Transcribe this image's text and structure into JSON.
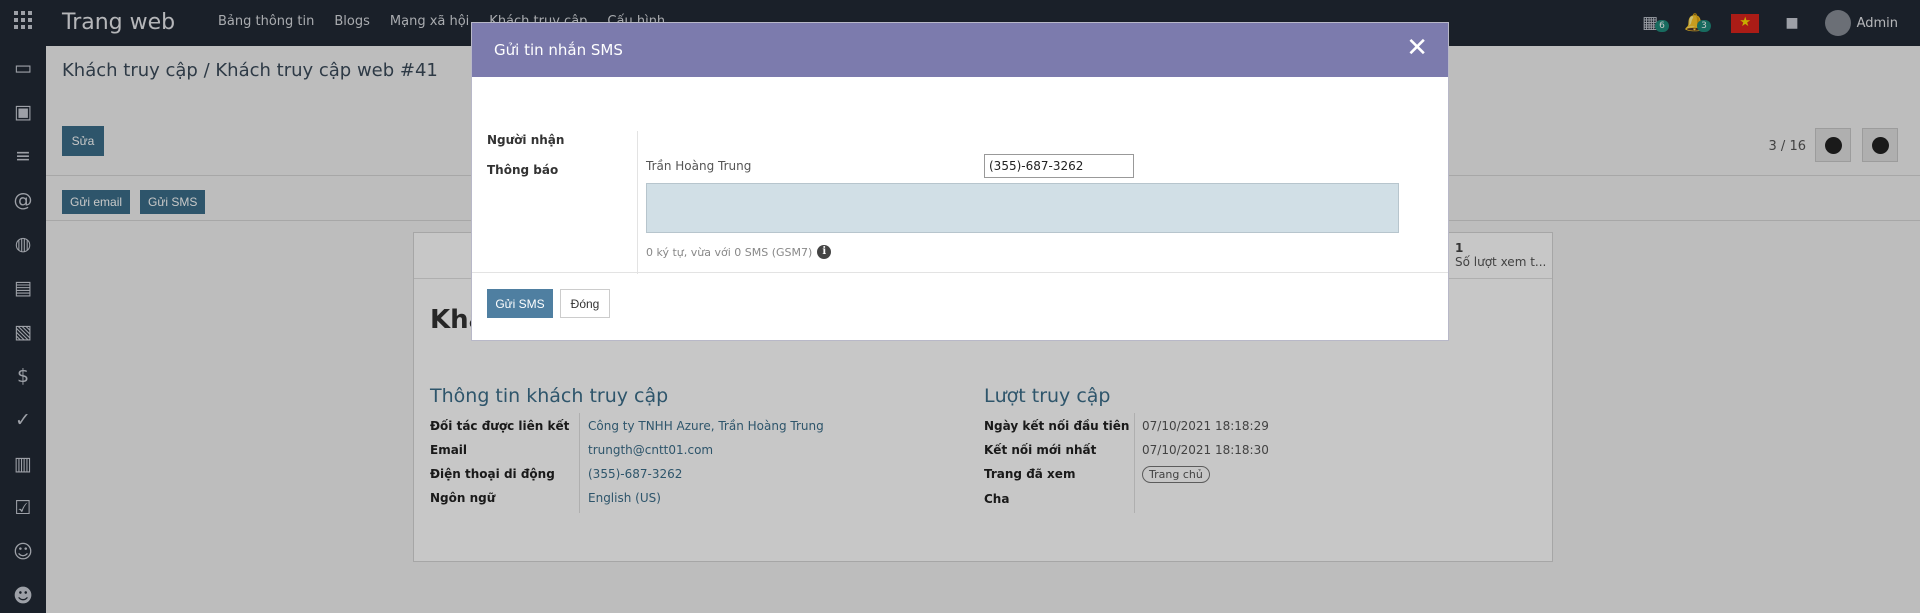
{
  "navbar": {
    "brand": "Trang web",
    "menu": [
      "Bảng thông tin",
      "Blogs",
      "Mạng xã hội",
      "Khách truy cập",
      "Cấu hình"
    ],
    "activity_count": "6",
    "notification_count": "3",
    "user": "Admin",
    "icons": [
      "apps-grid-icon",
      "calendar-icon",
      "bell-icon",
      "vietnam-flag-icon",
      "briefcase-icon",
      "avatar"
    ]
  },
  "sidebar_icons": [
    "discuss-icon",
    "calendar-icon",
    "notes-icon",
    "email-marketing-icon",
    "website-icon",
    "document-icon",
    "survey-icon",
    "dollar-icon",
    "todo-icon",
    "clipboard-icon",
    "checklist-icon",
    "smiley-icon",
    "contacts-icon"
  ],
  "breadcrumb": "Khách truy cập / Khách truy cập web #41",
  "edit_label": "Sửa",
  "pager": "3 / 16",
  "actions": {
    "send_email": "Gửi email",
    "send_sms": "Gửi SMS"
  },
  "stat": {
    "value": "1",
    "label": "Số lượt xem t..."
  },
  "sheet_title": "Khá",
  "visitor_info": {
    "title": "Thông tin khách truy cập",
    "fields": [
      {
        "label": "Đối tác được liên kết",
        "value": "Công ty TNHH Azure, Trần Hoàng Trung"
      },
      {
        "label": "Email",
        "value": "trungth@cntt01.com"
      },
      {
        "label": "Điện thoại di động",
        "value": "(355)-687-3262"
      },
      {
        "label": "Ngôn ngữ",
        "value": "English (US)"
      }
    ]
  },
  "visits": {
    "title": "Lượt truy cập",
    "fields": [
      {
        "label": "Ngày kết nối đầu tiên",
        "value": "07/10/2021 18:18:29"
      },
      {
        "label": "Kết nối mới nhất",
        "value": "07/10/2021 18:18:30"
      },
      {
        "label": "Trang đã xem",
        "value": "Trang chủ"
      },
      {
        "label": "Cha",
        "value": ""
      }
    ]
  },
  "modal": {
    "title": "Gửi tin nhắn SMS",
    "recipient_label": "Người nhận",
    "recipient_name": "Trần Hoàng Trung",
    "phone": "(355)-687-3262",
    "message_label": "Thông báo",
    "message": "",
    "counter": "0 ký tự, vừa với 0 SMS (GSM7)",
    "send_label": "Gửi SMS",
    "close_label": "Đóng"
  },
  "colors": {
    "navbar": "#222a35",
    "modal_header": "#7c7bad",
    "primary": "#3c6e8a",
    "message_bg": "#d1dfe6"
  }
}
